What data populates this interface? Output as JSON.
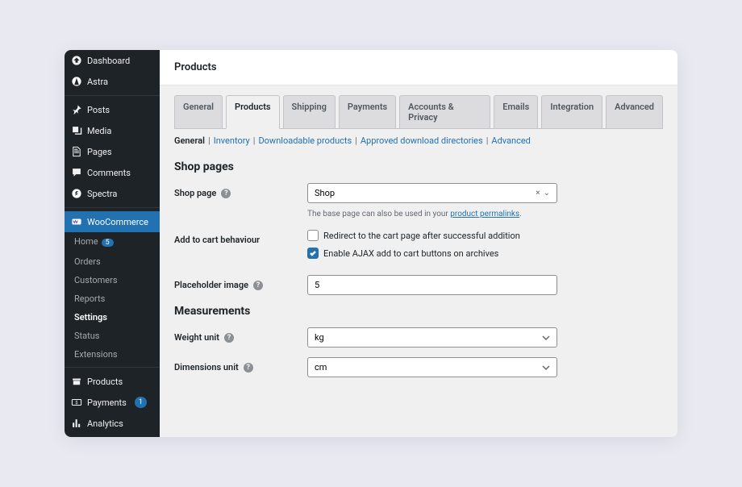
{
  "sidebar": {
    "top": [
      {
        "icon": "dashboard",
        "label": "Dashboard"
      },
      {
        "icon": "astra",
        "label": "Astra"
      }
    ],
    "middle": [
      {
        "icon": "pin",
        "label": "Posts"
      },
      {
        "icon": "media",
        "label": "Media"
      },
      {
        "icon": "pages",
        "label": "Pages"
      },
      {
        "icon": "comment",
        "label": "Comments"
      },
      {
        "icon": "spectra",
        "label": "Spectra"
      }
    ],
    "woo": {
      "label": "WooCommerce"
    },
    "woo_sub": [
      {
        "label": "Home",
        "badge": "5"
      },
      {
        "label": "Orders"
      },
      {
        "label": "Customers"
      },
      {
        "label": "Reports"
      },
      {
        "label": "Settings",
        "current": true
      },
      {
        "label": "Status"
      },
      {
        "label": "Extensions"
      }
    ],
    "bottom": [
      {
        "icon": "products",
        "label": "Products"
      },
      {
        "icon": "payments",
        "label": "Payments",
        "badge": "1"
      },
      {
        "icon": "analytics",
        "label": "Analytics"
      }
    ]
  },
  "header": {
    "title": "Products"
  },
  "tabs": [
    "General",
    "Products",
    "Shipping",
    "Payments",
    "Accounts & Privacy",
    "Emails",
    "Integration",
    "Advanced"
  ],
  "active_tab": "Products",
  "subtabs": [
    "General",
    "Inventory",
    "Downloadable products",
    "Approved download directories",
    "Advanced"
  ],
  "active_subtab": "General",
  "section1": {
    "heading": "Shop pages"
  },
  "shop_page": {
    "label": "Shop page",
    "value": "Shop",
    "hint_pre": "The base page can also be used in your ",
    "hint_link": "product permalinks",
    "hint_post": "."
  },
  "add_to_cart": {
    "label": "Add to cart behaviour",
    "opt1": "Redirect to the cart page after successful addition",
    "opt2": "Enable AJAX add to cart buttons on archives"
  },
  "placeholder": {
    "label": "Placeholder image",
    "value": "5"
  },
  "section2": {
    "heading": "Measurements"
  },
  "weight": {
    "label": "Weight unit",
    "value": "kg"
  },
  "dimensions": {
    "label": "Dimensions unit",
    "value": "cm"
  }
}
